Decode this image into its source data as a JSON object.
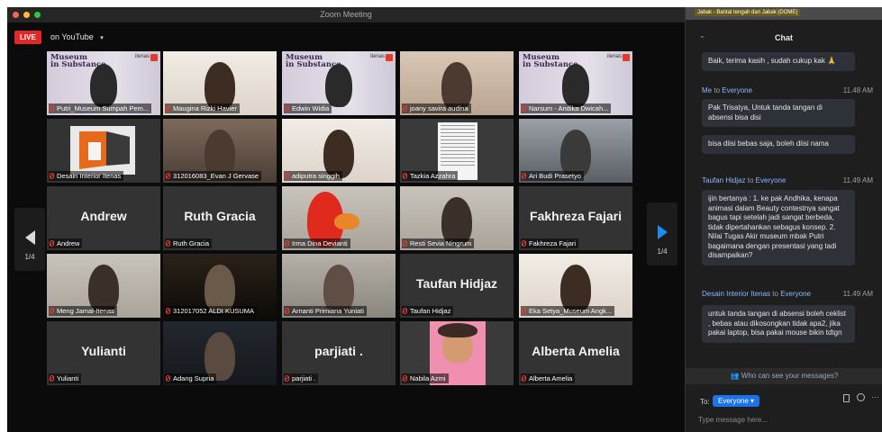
{
  "window": {
    "title": "Zoom Meeting",
    "dot_colors": [
      "#ff5f57",
      "#febc2e",
      "#28c840"
    ]
  },
  "live": {
    "badge": "LIVE",
    "platform": "on YouTube",
    "chevron": "▾"
  },
  "pager": {
    "left_page": "1/4",
    "right_page": "1/4"
  },
  "participants": [
    {
      "name": "Putri_Museum Sumpah Pem...",
      "video": "museum",
      "overlay": ""
    },
    {
      "name": "Maugina Rizki Havier",
      "video": "room",
      "overlay": ""
    },
    {
      "name": "Edwin Widia",
      "video": "museum",
      "overlay": ""
    },
    {
      "name": "joany savira audina",
      "video": "room2",
      "overlay": ""
    },
    {
      "name": "Narsum - Andika Dwicah...",
      "video": "museum",
      "overlay": ""
    },
    {
      "name": "Desain Interior Itenas",
      "video": "logo",
      "overlay": ""
    },
    {
      "name": "312016083_Evan J Gervase",
      "video": "red",
      "overlay": ""
    },
    {
      "name": "adiputra singgih",
      "video": "room",
      "overlay": ""
    },
    {
      "name": "Tazkia Azzahra",
      "video": "paper",
      "overlay": ""
    },
    {
      "name": "Ari Budi Prasetyo",
      "video": "bike",
      "overlay": ""
    },
    {
      "name": "Andrew",
      "video": "none",
      "overlay": "Andrew"
    },
    {
      "name": "Ruth Gracia",
      "video": "none",
      "overlay": "Ruth Gracia"
    },
    {
      "name": "Irma Dina Devianti",
      "video": "elmo",
      "overlay": ""
    },
    {
      "name": "Resti Sevia Ningrum",
      "video": "wall",
      "overlay": ""
    },
    {
      "name": "Fakhreza Fajari",
      "video": "none",
      "overlay": "Fakhreza Fajari"
    },
    {
      "name": "Meng Jamal-Itenas",
      "video": "wall",
      "overlay": ""
    },
    {
      "name": "312017052 ALDI KUSUMA",
      "video": "street",
      "overlay": ""
    },
    {
      "name": "Arnanti Primiana Yuniati",
      "video": "tree",
      "overlay": ""
    },
    {
      "name": "Taufan Hidjaz",
      "video": "none",
      "overlay": "Taufan Hidjaz"
    },
    {
      "name": "Eka Setya_Museum Angk...",
      "video": "room",
      "overlay": ""
    },
    {
      "name": "Yulianti",
      "video": "none",
      "overlay": "Yulianti"
    },
    {
      "name": "Adang Supria",
      "video": "dark",
      "overlay": ""
    },
    {
      "name": "parjiati .",
      "video": "none",
      "overlay": "parjiati ."
    },
    {
      "name": "Nabila Azmi",
      "video": "cartoon",
      "overlay": ""
    },
    {
      "name": "Alberta Amelia",
      "video": "none",
      "overlay": "Alberta Amelia"
    }
  ],
  "museum_logo": {
    "line1": "Museum",
    "line2": "in Substance",
    "brand": "itenas"
  },
  "chat": {
    "topbar_text": "Jabak - Bantal tengah dan Jabak (DOME)",
    "collapse_icon": "⌄",
    "title": "Chat",
    "messages": [
      {
        "bubble": "Baik, terima kasih , sudah cukup kak 🙏"
      },
      {
        "from": "Me",
        "to_word": "to",
        "to": "Everyone",
        "time": "11.48 AM"
      },
      {
        "bubble": "Pak Trisatya, Untuk tanda tangan di absensi bisa disi"
      },
      {
        "bubble": "bisa diisi bebas saja, boleh diisi nama"
      },
      {
        "from": "Taufan Hidjaz",
        "to_word": "to",
        "to": "Everyone",
        "time": "11.49 AM"
      },
      {
        "bubble": "ijin bertanya : 1. ke pak Andhika, kenapa animasi dalam Beauty contestnya  sangat bagus tapi setelah jadi sangat berbeda, tidak dipertahankan sebagus konsep. 2. Nilai Tugas Akir museum mbak Putri bagaimana dengan presentasi yang tadi disampaikan?"
      },
      {
        "from": "Desain Interior Itenas",
        "to_word": "to",
        "to": "Everyone",
        "time": "11.49 AM"
      },
      {
        "bubble": "untuk tanda tangan di absensi boleh ceklist , bebas atau dikosongkan tidak apa2, jika pakai laptop, bisa pakai mouse  bikin tdtgn"
      }
    ],
    "who_can_see": "Who can see your messages?",
    "who_icon": "👥",
    "to_label": "To:",
    "to_value": "Everyone ▾",
    "more_icon": "···",
    "input_placeholder": "Type message here..."
  }
}
